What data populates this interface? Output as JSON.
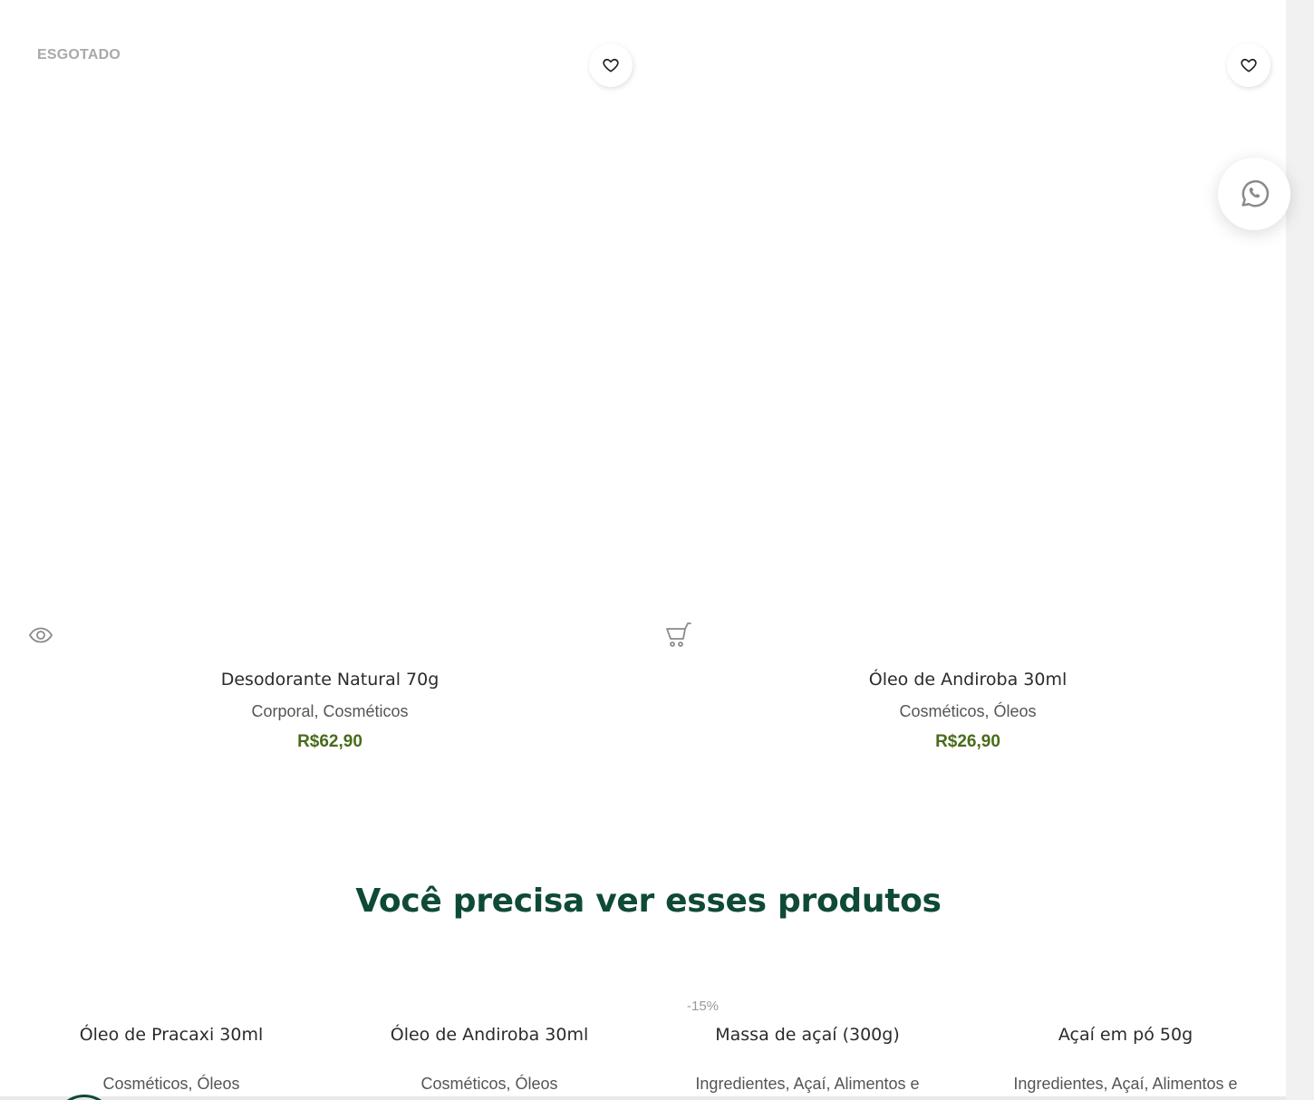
{
  "featured": {
    "soldout_badge": "ESGOTADO",
    "products": [
      {
        "name": "Desodorante Natural 70g",
        "categories": "Corporal, Cosméticos",
        "price": "R$62,90"
      },
      {
        "name": "Óleo de Andiroba 30ml",
        "categories": "Cosméticos, Óleos",
        "price": "R$26,90"
      }
    ]
  },
  "related": {
    "title": "Você precisa ver esses produtos",
    "discount_badge": "-15%",
    "products": [
      {
        "name": "Óleo de Pracaxi 30ml",
        "categories": "Cosméticos, Óleos"
      },
      {
        "name": "Óleo de Andiroba 30ml",
        "categories": "Cosméticos, Óleos"
      },
      {
        "name": "Massa de açaí (300g)",
        "categories": "Ingredientes, Açaí, Alimentos e"
      },
      {
        "name": "Açaí em pó 50g",
        "categories": "Ingredientes, Açaí, Alimentos e"
      }
    ]
  },
  "icons": {
    "wishlist": "heart-icon",
    "whatsapp": "whatsapp-icon",
    "quick_view": "eye-icon",
    "add_to_cart": "cart-icon"
  },
  "colors": {
    "title_green": "#0f4a36",
    "price_green": "#4a6b1a"
  }
}
